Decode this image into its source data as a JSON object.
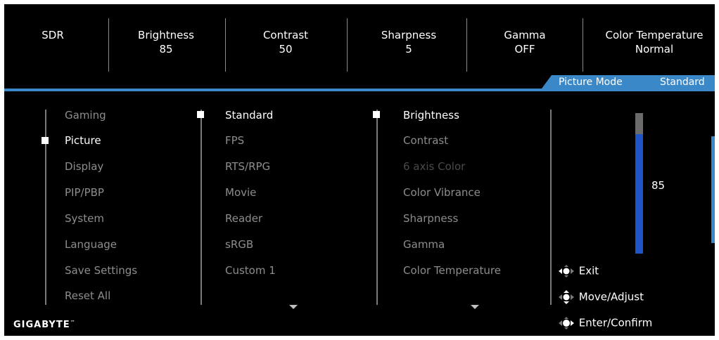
{
  "status": {
    "items": [
      {
        "label": "SDR",
        "value": ""
      },
      {
        "label": "Brightness",
        "value": "85"
      },
      {
        "label": "Contrast",
        "value": "50"
      },
      {
        "label": "Sharpness",
        "value": "5"
      },
      {
        "label": "Gamma",
        "value": "OFF"
      },
      {
        "label": "Color Temperature",
        "value": "Normal"
      }
    ]
  },
  "mode": {
    "label": "Picture Mode",
    "value": "Standard"
  },
  "menu": {
    "items": [
      "Gaming",
      "Picture",
      "Display",
      "PIP/PBP",
      "System",
      "Language",
      "Save Settings",
      "Reset All"
    ],
    "selected": "Picture"
  },
  "modes": {
    "items": [
      "Standard",
      "FPS",
      "RTS/RPG",
      "Movie",
      "Reader",
      "sRGB",
      "Custom 1"
    ],
    "selected": "Standard"
  },
  "settings": {
    "items": [
      "Brightness",
      "Contrast",
      "6 axis Color",
      "Color Vibrance",
      "Sharpness",
      "Gamma",
      "Color Temperature"
    ],
    "selected": "Brightness",
    "disabled": "6 axis Color"
  },
  "slider": {
    "value": "85",
    "fraction": 0.85
  },
  "help": {
    "exit": "Exit",
    "move": "Move/Adjust",
    "enter": "Enter/Confirm"
  },
  "brand": {
    "logo": "GIGABYTE",
    "tm": "™"
  },
  "colors": {
    "accent": "#3b88c8",
    "slider_fill": "#1f55c8",
    "background": "#000000"
  }
}
